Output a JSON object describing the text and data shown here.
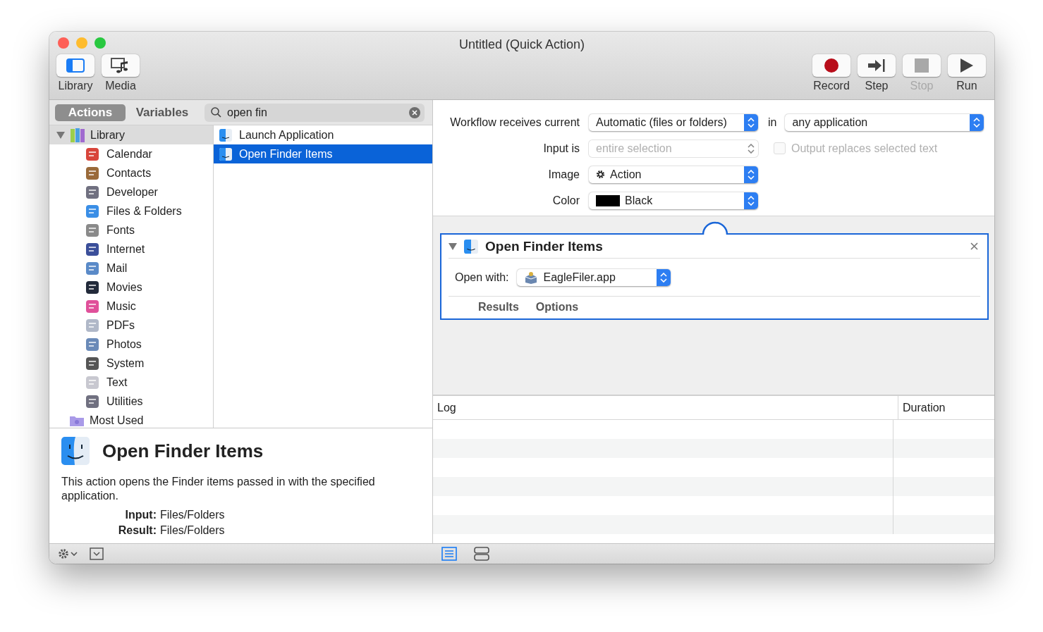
{
  "window": {
    "title": "Untitled (Quick Action)"
  },
  "toolbar_left": [
    {
      "label": "Library",
      "kind": "library"
    },
    {
      "label": "Media",
      "kind": "media"
    }
  ],
  "toolbar_right": [
    {
      "label": "Record",
      "kind": "record",
      "disabled": false
    },
    {
      "label": "Step",
      "kind": "step",
      "disabled": false
    },
    {
      "label": "Stop",
      "kind": "stop",
      "disabled": true
    },
    {
      "label": "Run",
      "kind": "run",
      "disabled": false
    }
  ],
  "tabs": [
    {
      "label": "Actions",
      "selected": true
    },
    {
      "label": "Variables",
      "selected": false
    }
  ],
  "search": {
    "value": "open fin"
  },
  "library": {
    "label": "Library",
    "expanded": true,
    "children": [
      {
        "label": "Calendar"
      },
      {
        "label": "Contacts"
      },
      {
        "label": "Developer"
      },
      {
        "label": "Files & Folders"
      },
      {
        "label": "Fonts"
      },
      {
        "label": "Internet"
      },
      {
        "label": "Mail"
      },
      {
        "label": "Movies"
      },
      {
        "label": "Music"
      },
      {
        "label": "PDFs"
      },
      {
        "label": "Photos"
      },
      {
        "label": "System"
      },
      {
        "label": "Text"
      },
      {
        "label": "Utilities"
      }
    ]
  },
  "most_used": {
    "label": "Most Used"
  },
  "actions": [
    {
      "label": "Launch Application",
      "selected": false
    },
    {
      "label": "Open Finder Items",
      "selected": true
    }
  ],
  "description": {
    "title": "Open Finder Items",
    "text": "This action opens the Finder items passed in with the specified application.",
    "input_label": "Input:",
    "input_value": "Files/Folders",
    "result_label": "Result:",
    "result_value": "Files/Folders"
  },
  "workflow": {
    "receives_label": "Workflow receives current",
    "receives_value": "Automatic (files or folders)",
    "in_label": "in",
    "in_value": "any application",
    "input_label": "Input is",
    "input_value": "entire selection",
    "input_disabled": true,
    "output_checkbox": {
      "label": "Output replaces selected text",
      "checked": false,
      "disabled": true
    },
    "image_label": "Image",
    "image_value": "Action",
    "color_label": "Color",
    "color_value": "Black",
    "color": "#000000"
  },
  "action_card": {
    "title": "Open Finder Items",
    "expanded": true,
    "open_with_label": "Open with:",
    "open_with_value": "EagleFiler.app",
    "tabs": [
      "Results",
      "Options"
    ]
  },
  "log": {
    "columns": [
      "Log",
      "Duration"
    ]
  }
}
